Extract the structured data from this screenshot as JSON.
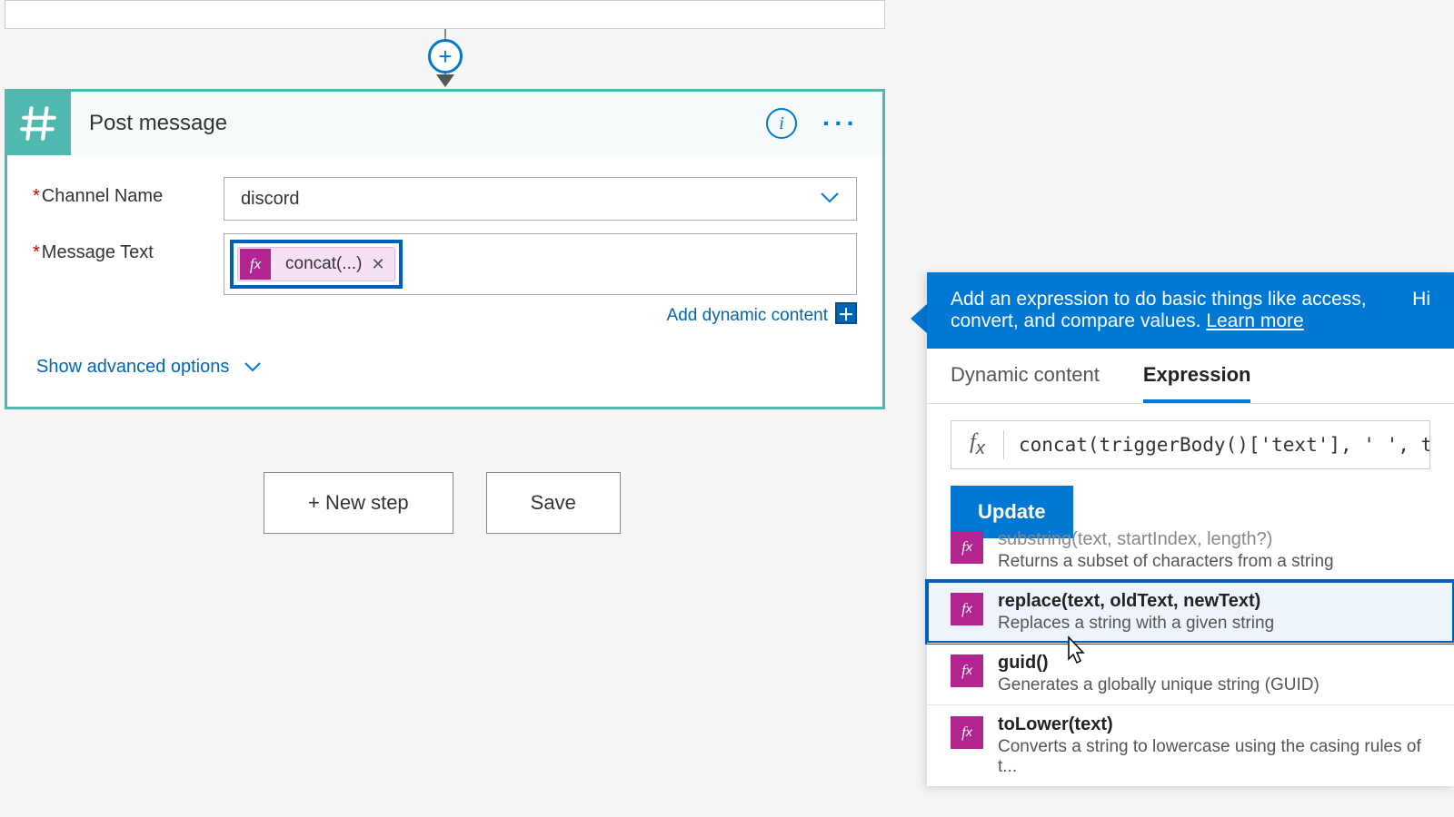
{
  "action": {
    "title": "Post message",
    "fields": {
      "channel": {
        "label": "Channel Name",
        "value": "discord"
      },
      "message": {
        "label": "Message Text",
        "token": "concat(...)"
      }
    },
    "addDynamicLabel": "Add dynamic content",
    "showAdvanced": "Show advanced options"
  },
  "buttons": {
    "newStep": "+ New step",
    "save": "Save"
  },
  "panel": {
    "headText": "Add an expression to do basic things like access, convert, and compare values. ",
    "learnMore": "Learn more",
    "hide": "Hi",
    "tabs": {
      "dynamic": "Dynamic content",
      "expression": "Expression"
    },
    "expression": "concat(triggerBody()['text'], ' ', trigg",
    "update": "Update",
    "funcs": [
      {
        "sig": "substring(text, startIndex, length?)",
        "desc": "Returns a subset of characters from a string",
        "partial": true
      },
      {
        "sig": "replace(text, oldText, newText)",
        "desc": "Replaces a string with a given string",
        "selected": true
      },
      {
        "sig": "guid()",
        "desc": "Generates a globally unique string (GUID)"
      },
      {
        "sig": "toLower(text)",
        "desc": "Converts a string to lowercase using the casing rules of t..."
      }
    ]
  }
}
